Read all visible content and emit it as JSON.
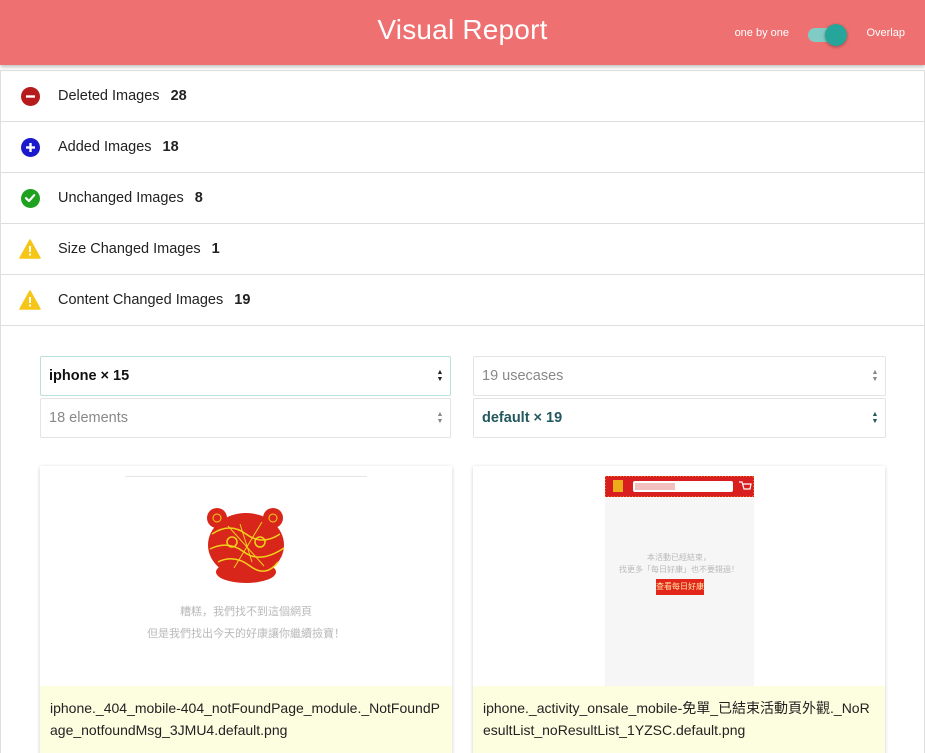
{
  "header": {
    "title": "Visual Report",
    "mode_left": "one by one",
    "mode_right": "Overlap",
    "toggle_on": true
  },
  "categories": [
    {
      "label": "Deleted Images",
      "count": "28",
      "icon": "minus-circle-icon",
      "color": "#b71c1c"
    },
    {
      "label": "Added Images",
      "count": "18",
      "icon": "plus-circle-icon",
      "color": "#1a1acc"
    },
    {
      "label": "Unchanged Images",
      "count": "8",
      "icon": "check-circle-icon",
      "color": "#1fa21f"
    },
    {
      "label": "Size Changed Images",
      "count": "1",
      "icon": "warning-icon",
      "color": "#f5c518"
    },
    {
      "label": "Content Changed Images",
      "count": "19",
      "icon": "warning-icon",
      "color": "#f5c518"
    }
  ],
  "filters": {
    "device": "iphone × 15",
    "usecases": "19 usecases",
    "elements": "18 elements",
    "variant": "default × 19"
  },
  "cards": [
    {
      "filename": "iphone._404_mobile-404_notFoundPage_module._NotFoundPage_notfoundMsg_3JMU4.default.png",
      "msg_line1": "糟糕，我們找不到這個網頁",
      "msg_line2": "但是我們找出今天的好康讓你繼續撿寶！"
    },
    {
      "filename": "iphone._activity_onsale_mobile-免單_已結束活動頁外觀._NoResultList_noResultList_1YZSC.default.png",
      "msg_line1": "本活動已經結束，",
      "msg_line2": "找更多「每日好康」也不要錯過！",
      "button_label": "查看每日好康"
    }
  ]
}
